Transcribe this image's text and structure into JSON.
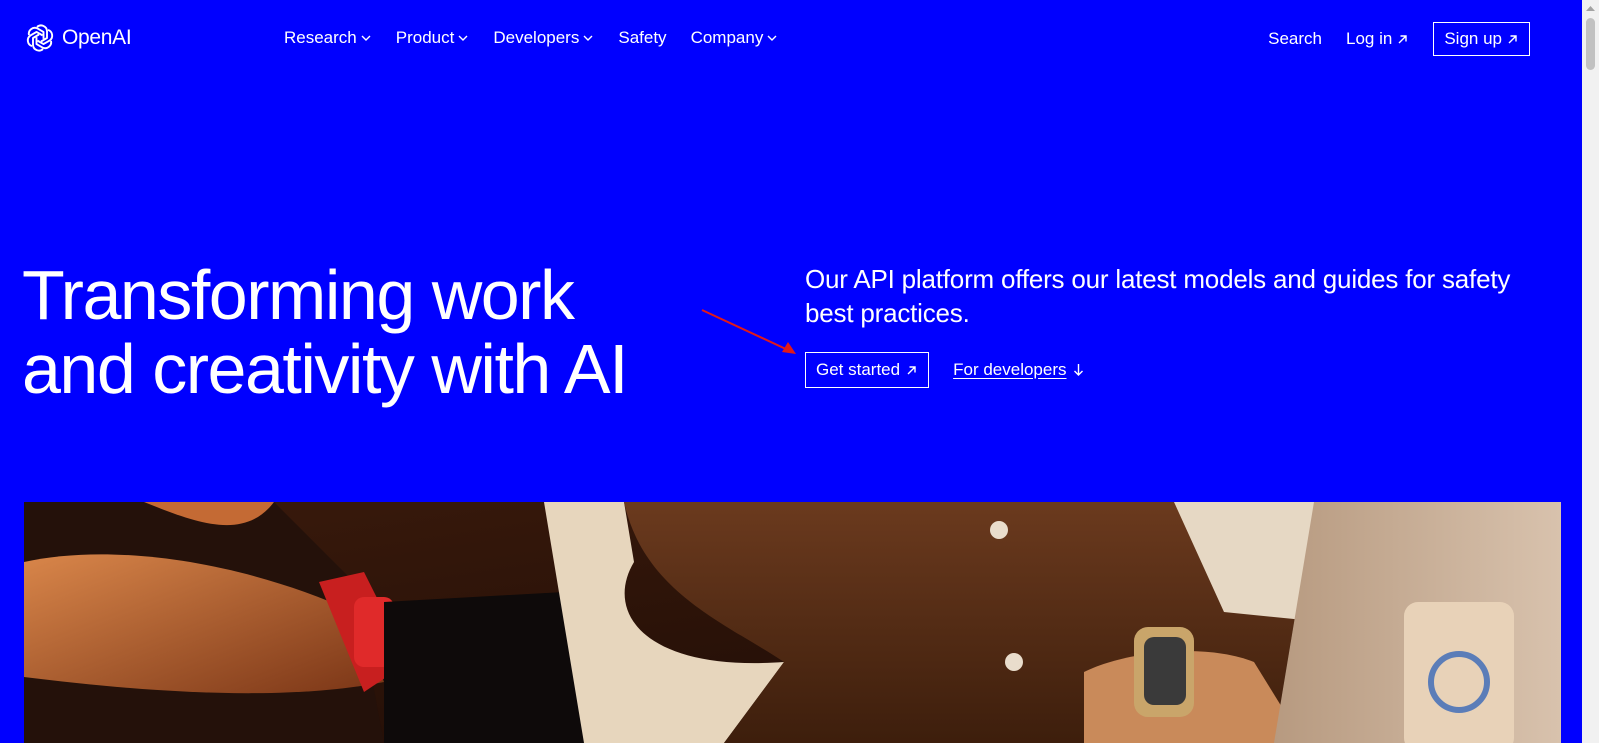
{
  "brand": {
    "name": "OpenAI"
  },
  "nav": {
    "items": [
      {
        "label": "Research"
      },
      {
        "label": "Product"
      },
      {
        "label": "Developers"
      },
      {
        "label": "Safety"
      },
      {
        "label": "Company"
      }
    ],
    "search_label": "Search",
    "login_label": "Log in",
    "signup_label": "Sign up"
  },
  "hero": {
    "title_line1": "Transforming work",
    "title_line2": "and creativity with AI",
    "description": "Our API platform offers our latest models and guides for safety best practices.",
    "get_started_label": "Get started",
    "for_developers_label": "For developers"
  },
  "colors": {
    "background": "#0000ff",
    "text": "#ffffff",
    "annotation_arrow": "#e11919"
  }
}
